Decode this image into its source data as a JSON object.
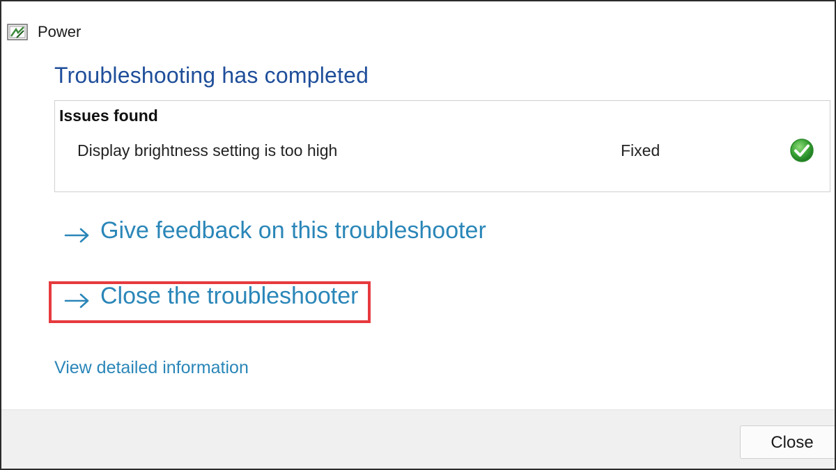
{
  "window": {
    "title": "Power",
    "icon": "power-troubleshooter-icon"
  },
  "main": {
    "heading": "Troubleshooting has completed",
    "issues": {
      "title": "Issues found",
      "items": [
        {
          "description": "Display brightness setting is too high",
          "status": "Fixed",
          "status_icon": "green-check-icon"
        }
      ]
    },
    "links": {
      "feedback": "Give feedback on this troubleshooter",
      "close_troubleshooter": "Close the troubleshooter",
      "details": "View detailed information"
    }
  },
  "footer": {
    "close_label": "Close"
  },
  "colors": {
    "heading": "#1f4e9a",
    "link": "#2a86b8",
    "highlight": "#e63a3f",
    "check": "#3aa336"
  }
}
